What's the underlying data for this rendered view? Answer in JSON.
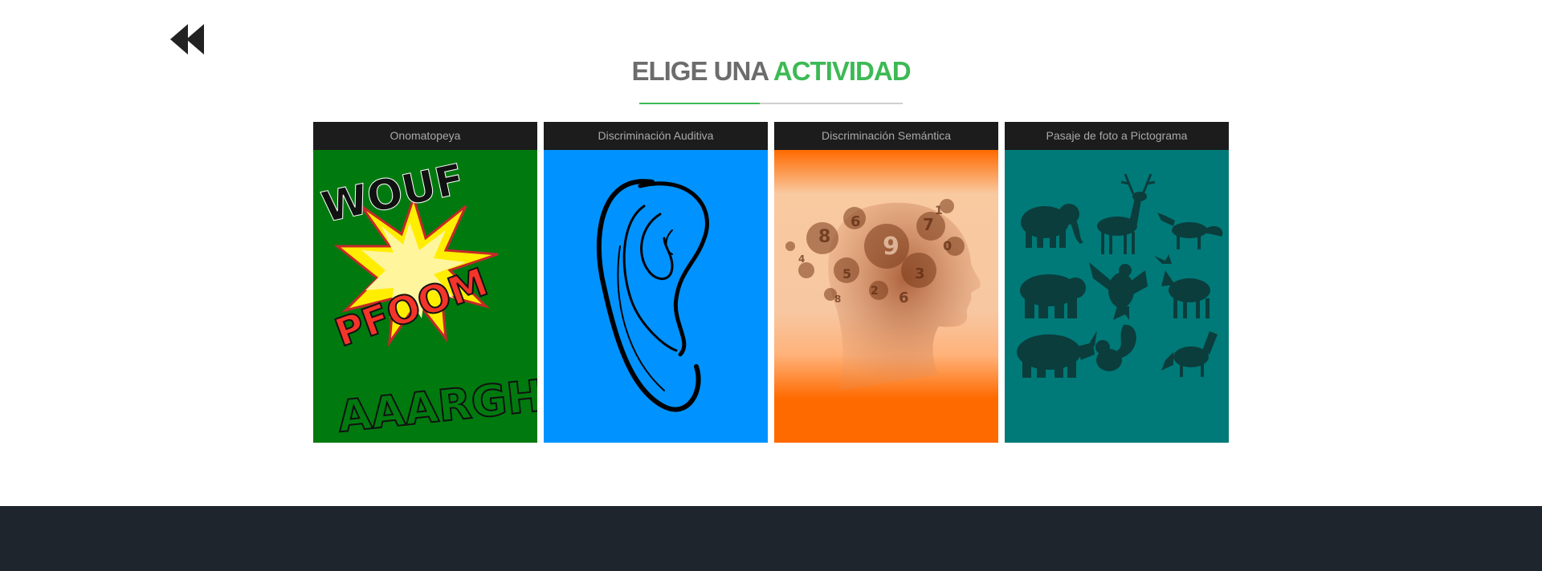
{
  "header": {
    "back_icon": "double-chevron-left-icon",
    "title_part1": "ELIGE UNA",
    "title_part2": "ACTIVIDAD",
    "accent_color": "#3cba54",
    "title_color": "#6c6c6c"
  },
  "cards": [
    {
      "label": "Onomatopeya",
      "bg": "#007a0f",
      "image_text": [
        "WOUF",
        "PFOOM",
        "AAARGH!"
      ]
    },
    {
      "label": "Discriminación Auditiva",
      "bg": "#0093ff",
      "image": "ear-drawing"
    },
    {
      "label": "Discriminación Semántica",
      "bg": "#ff6a00",
      "image": "head-with-numbers"
    },
    {
      "label": "Pasaje de foto a Pictograma",
      "bg": "#007a78",
      "image": "animal-silhouettes"
    }
  ],
  "footer": {
    "bg": "#1f252d"
  }
}
